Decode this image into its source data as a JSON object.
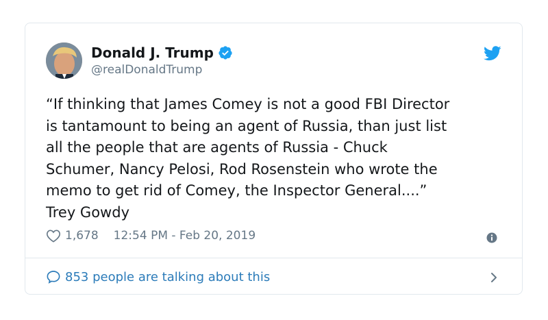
{
  "author": {
    "display_name": "Donald J. Trump",
    "handle": "@realDonaldTrump",
    "verified": true
  },
  "tweet": {
    "text": "“If thinking that James Comey is not a good FBI Director\nis tantamount to being an agent of Russia, than just list\nall the people that are agents of Russia - Chuck\nSchumer, Nancy Pelosi, Rod Rosenstein who wrote the\nmemo to get rid of Comey, the Inspector General....”\nTrey Gowdy",
    "like_count": "1,678",
    "timestamp": "12:54 PM - Feb 20, 2019"
  },
  "footer": {
    "talking_text": "853 people are talking about this"
  },
  "icons": {
    "brand": "twitter-bird-icon",
    "verified": "verified-badge-icon",
    "like": "heart-icon",
    "info": "info-icon",
    "reply": "speech-bubble-icon",
    "chevron": "chevron-right-icon"
  },
  "colors": {
    "twitter_blue": "#1da1f2",
    "link_blue": "#2b7bb9",
    "secondary_text": "#657786",
    "border": "#e1e8ed"
  }
}
